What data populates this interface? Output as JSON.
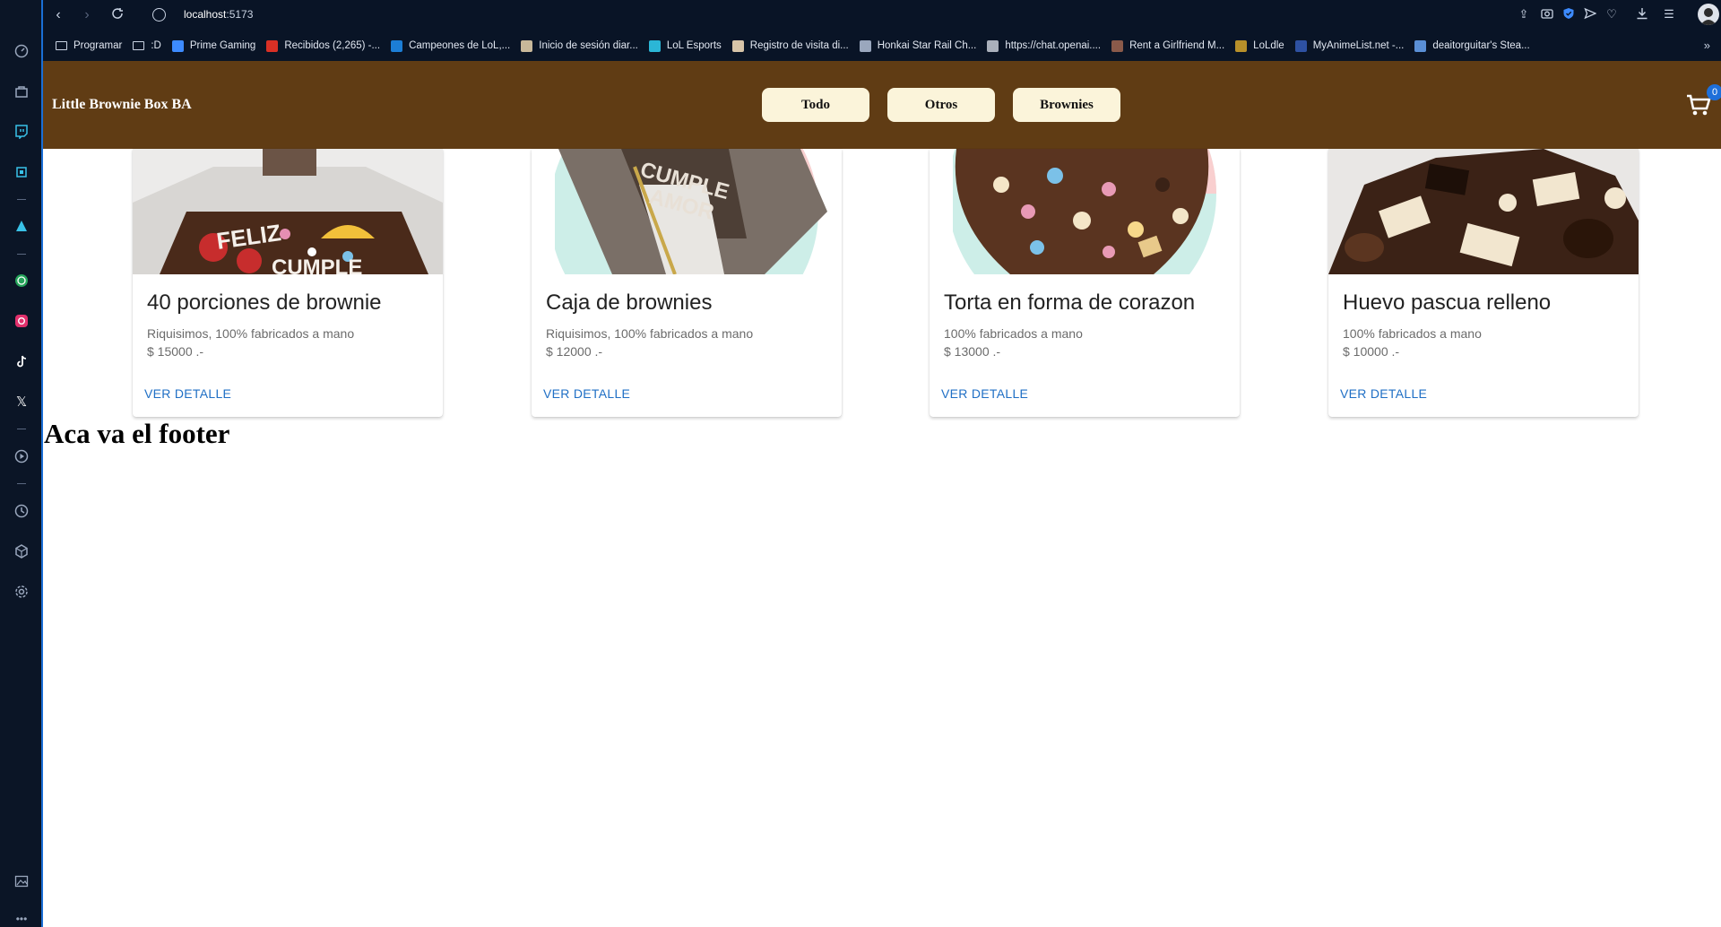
{
  "browser": {
    "address": "localhost",
    "port": ":5173",
    "bookmarks": [
      {
        "label": "Programar",
        "color": "#091426"
      },
      {
        "label": ":D",
        "color": "#091426"
      },
      {
        "label": "Prime Gaming",
        "color": "#3d8bff"
      },
      {
        "label": "Recibidos (2,265) -...",
        "color": "#d93025"
      },
      {
        "label": "Campeones de LoL,...",
        "color": "#1c7ed6"
      },
      {
        "label": "Inicio de sesión diar...",
        "color": "#c8b89a"
      },
      {
        "label": "LoL Esports",
        "color": "#2bb6d6"
      },
      {
        "label": "Registro de visita di...",
        "color": "#d7c4a8"
      },
      {
        "label": "Honkai Star Rail Ch...",
        "color": "#9aa7bd"
      },
      {
        "label": "https://chat.openai....",
        "color": "#aab0bb"
      },
      {
        "label": "Rent a Girlfriend M...",
        "color": "#8a5a4a"
      },
      {
        "label": "LoLdle",
        "color": "#b8902a"
      },
      {
        "label": "MyAnimeList.net -...",
        "color": "#2e51a2"
      },
      {
        "label": "deaitorguitar's Stea...",
        "color": "#5a8fd6"
      }
    ]
  },
  "header": {
    "brand": "Little Brownie Box BA",
    "categories": [
      "Todo",
      "Otros",
      "Brownies"
    ],
    "cart_count": "0"
  },
  "products": [
    {
      "title": "40 porciones de brownie",
      "desc": "Riquisimos, 100% fabricados a mano",
      "price": "$ 15000 .-",
      "link": "VER DETALLE"
    },
    {
      "title": "Caja de brownies",
      "desc": "Riquisimos, 100% fabricados a mano",
      "price": "$ 12000 .-",
      "link": "VER DETALLE"
    },
    {
      "title": "Torta en forma de corazon",
      "desc": "100% fabricados a mano",
      "price": "$ 13000 .-",
      "link": "VER DETALLE"
    },
    {
      "title": "Huevo pascua relleno",
      "desc": "100% fabricados a mano",
      "price": "$ 10000 .-",
      "link": "VER DETALLE"
    }
  ],
  "footer": {
    "text": "Aca va el footer"
  },
  "colors": {
    "header_bg": "#603c14",
    "button_bg": "#fbf4da",
    "link": "#1f6fc5"
  }
}
